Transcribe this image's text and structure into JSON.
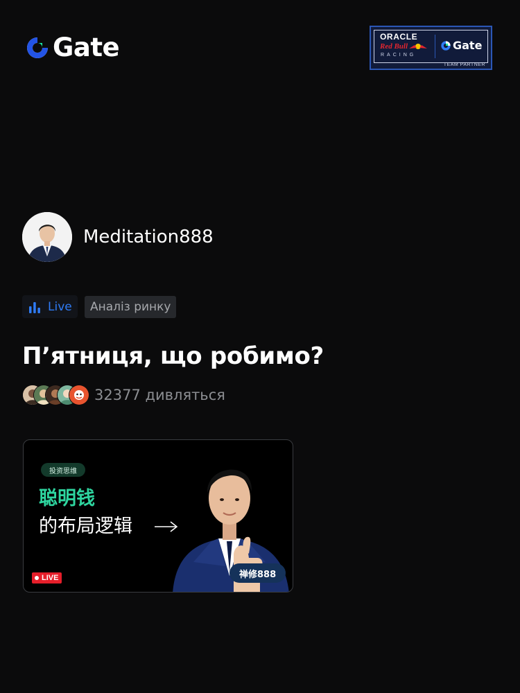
{
  "header": {
    "brand": "Gate",
    "partner_badge": {
      "line1": "ORACLE",
      "line2": "Red Bull",
      "line3": "RACING",
      "brand": "Gate",
      "caption": "TEAM PARTNER"
    }
  },
  "streamer": {
    "username": "Meditation888"
  },
  "tags": {
    "live": "Live",
    "category": "Аналіз ринку"
  },
  "stream": {
    "title": "П’ятниця, що робимо?",
    "viewers": "32377 дивляться"
  },
  "thumbnail": {
    "pill": "投资思维",
    "line1": "聪明钱",
    "line2": "的布局逻辑",
    "name_badge": "禅修888",
    "live_label": "LIVE"
  },
  "colors": {
    "background": "#0b0b0c",
    "accent_blue": "#2f7cf6",
    "accent_green": "#2ed59f",
    "live_red": "#e51e2a",
    "muted_text": "#8c8e92"
  },
  "icons": {
    "brand_logo": "gate-logo-icon",
    "live_tag": "bar-chart-icon",
    "arrow": "arrow-right-icon"
  }
}
